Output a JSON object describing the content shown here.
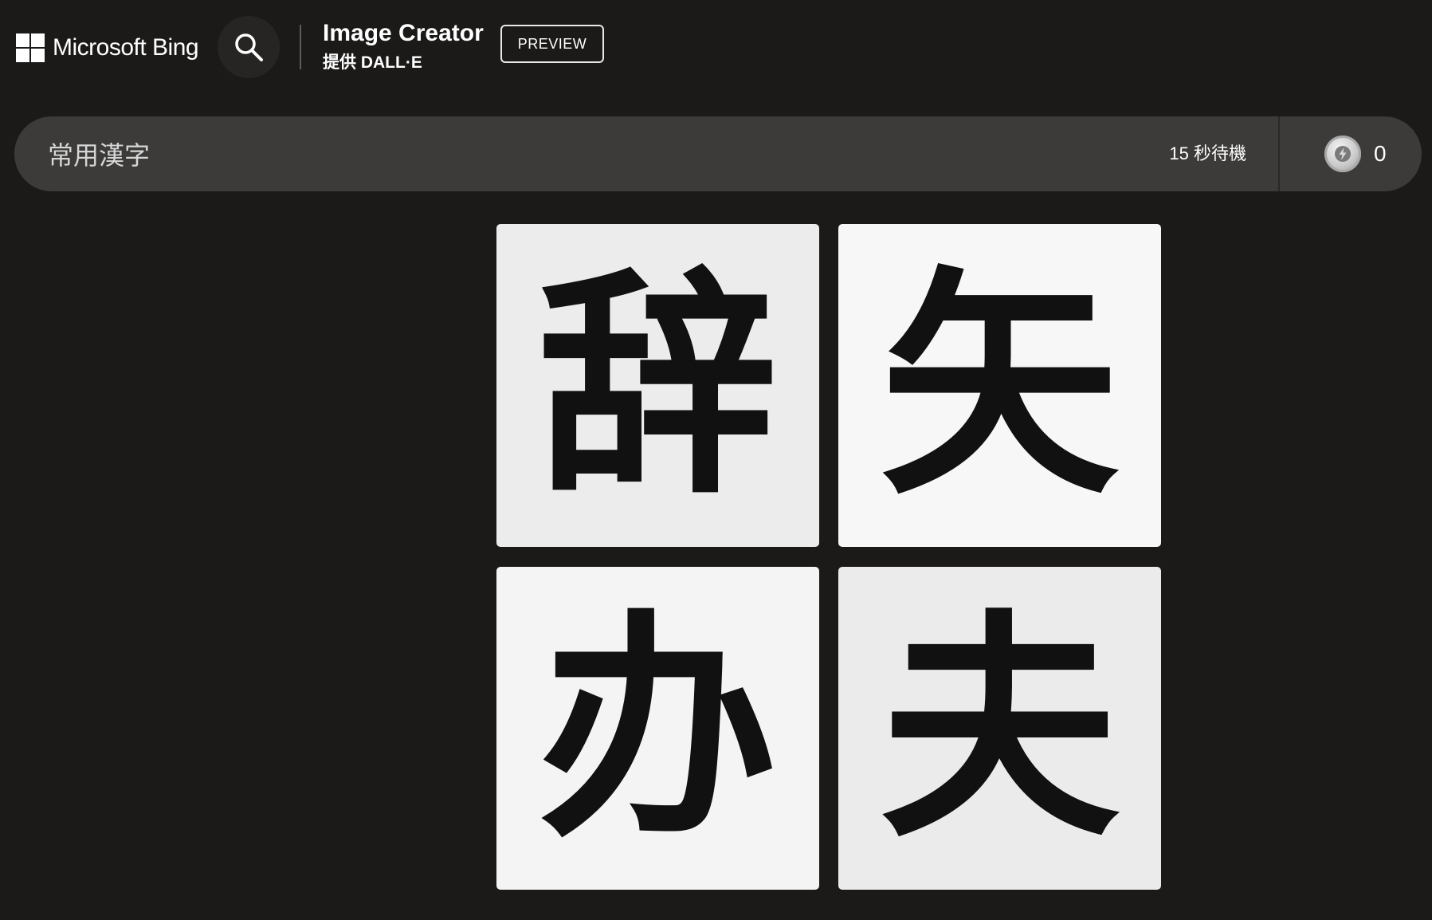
{
  "header": {
    "brand": "Microsoft Bing",
    "brand_icon": "microsoft-logo-icon",
    "search_icon": "search-icon",
    "title": "Image Creator",
    "subtitle": "提供 DALL·E",
    "badge": "PREVIEW"
  },
  "prompt": {
    "value": "常用漢字",
    "wait_text": "15 秒待機",
    "boost_icon": "boost-coin-icon",
    "boost_count": "0"
  },
  "results": {
    "images": [
      {
        "glyph": "辞",
        "background": "#ececec"
      },
      {
        "glyph": "矢",
        "background": "#f7f7f7"
      },
      {
        "glyph": "办",
        "background": "#f4f4f4"
      },
      {
        "glyph": "夫",
        "background": "#ebebeb"
      }
    ]
  },
  "colors": {
    "page_background": "#1b1a19",
    "prompt_bar": "#3c3b3a",
    "search_button": "#262524"
  }
}
